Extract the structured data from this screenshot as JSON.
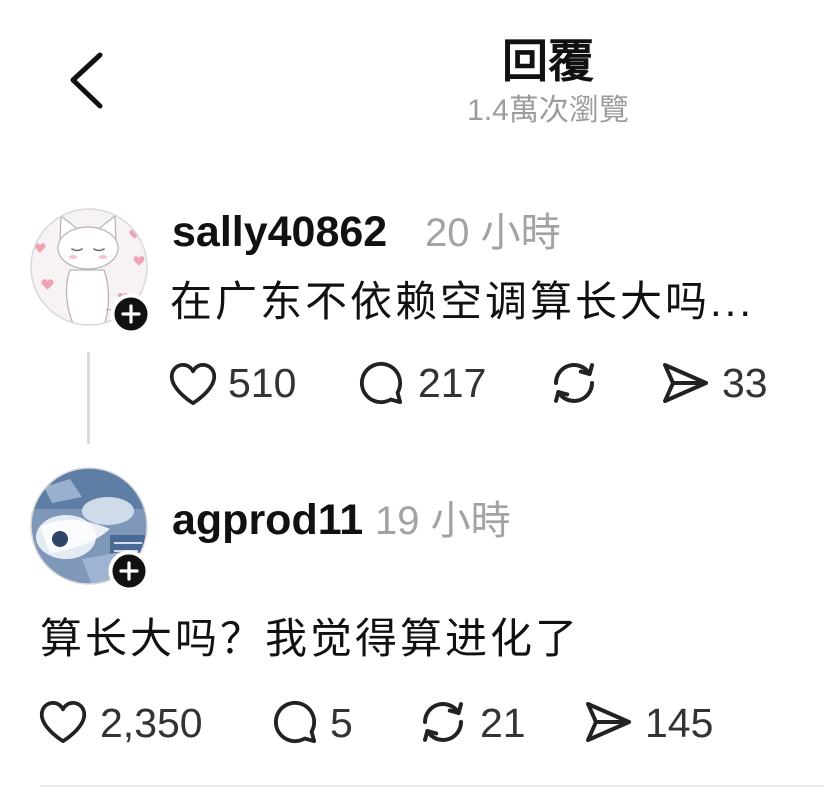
{
  "header": {
    "title": "回覆",
    "views": "1.4萬次瀏覽",
    "back_icon": "chevron-left-icon"
  },
  "posts": [
    {
      "username": "sally40862",
      "time": "20 小時",
      "text": "在广东不依赖空调算长大吗...",
      "likes": "510",
      "replies": "217",
      "shares": "33"
    },
    {
      "username": "agprod11",
      "time": "19 小時",
      "text": "算长大吗？我觉得算进化了",
      "likes": "2,350",
      "replies": "5",
      "reposts": "21",
      "shares": "145"
    }
  ],
  "icons": {
    "follow": "plus-icon",
    "like": "heart-icon",
    "reply": "comment-icon",
    "repost": "repost-icon",
    "share": "send-icon"
  },
  "colors": {
    "text_primary": "#111111",
    "text_secondary": "#9c9c9c",
    "badge": "#111111",
    "thread_line": "#dcdcdc",
    "divider": "#e9e9e9"
  }
}
